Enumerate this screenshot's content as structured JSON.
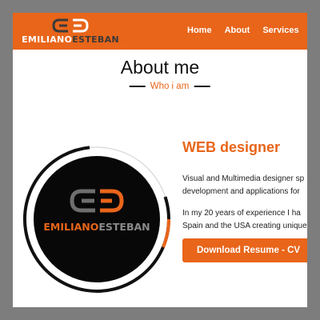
{
  "brand": {
    "first": "EMILIANO",
    "last": "ESTEBAN"
  },
  "nav": {
    "items": [
      "Home",
      "About",
      "Services"
    ]
  },
  "about": {
    "title": "About me",
    "subtitle": "Who i am",
    "role": "WEB designer",
    "paragraph1": [
      "Visual and Multimedia designer sp",
      "development and applications for"
    ],
    "paragraph2": [
      "In my 20 years of experience I ha",
      "Spain and the USA creating unique"
    ],
    "button_label": "Download Resume - CV"
  },
  "colors": {
    "accent": "#e8651a",
    "dark": "#111111",
    "frame": "#7d7d7d"
  },
  "icons": {
    "logo": "ee-monogram-logo"
  }
}
